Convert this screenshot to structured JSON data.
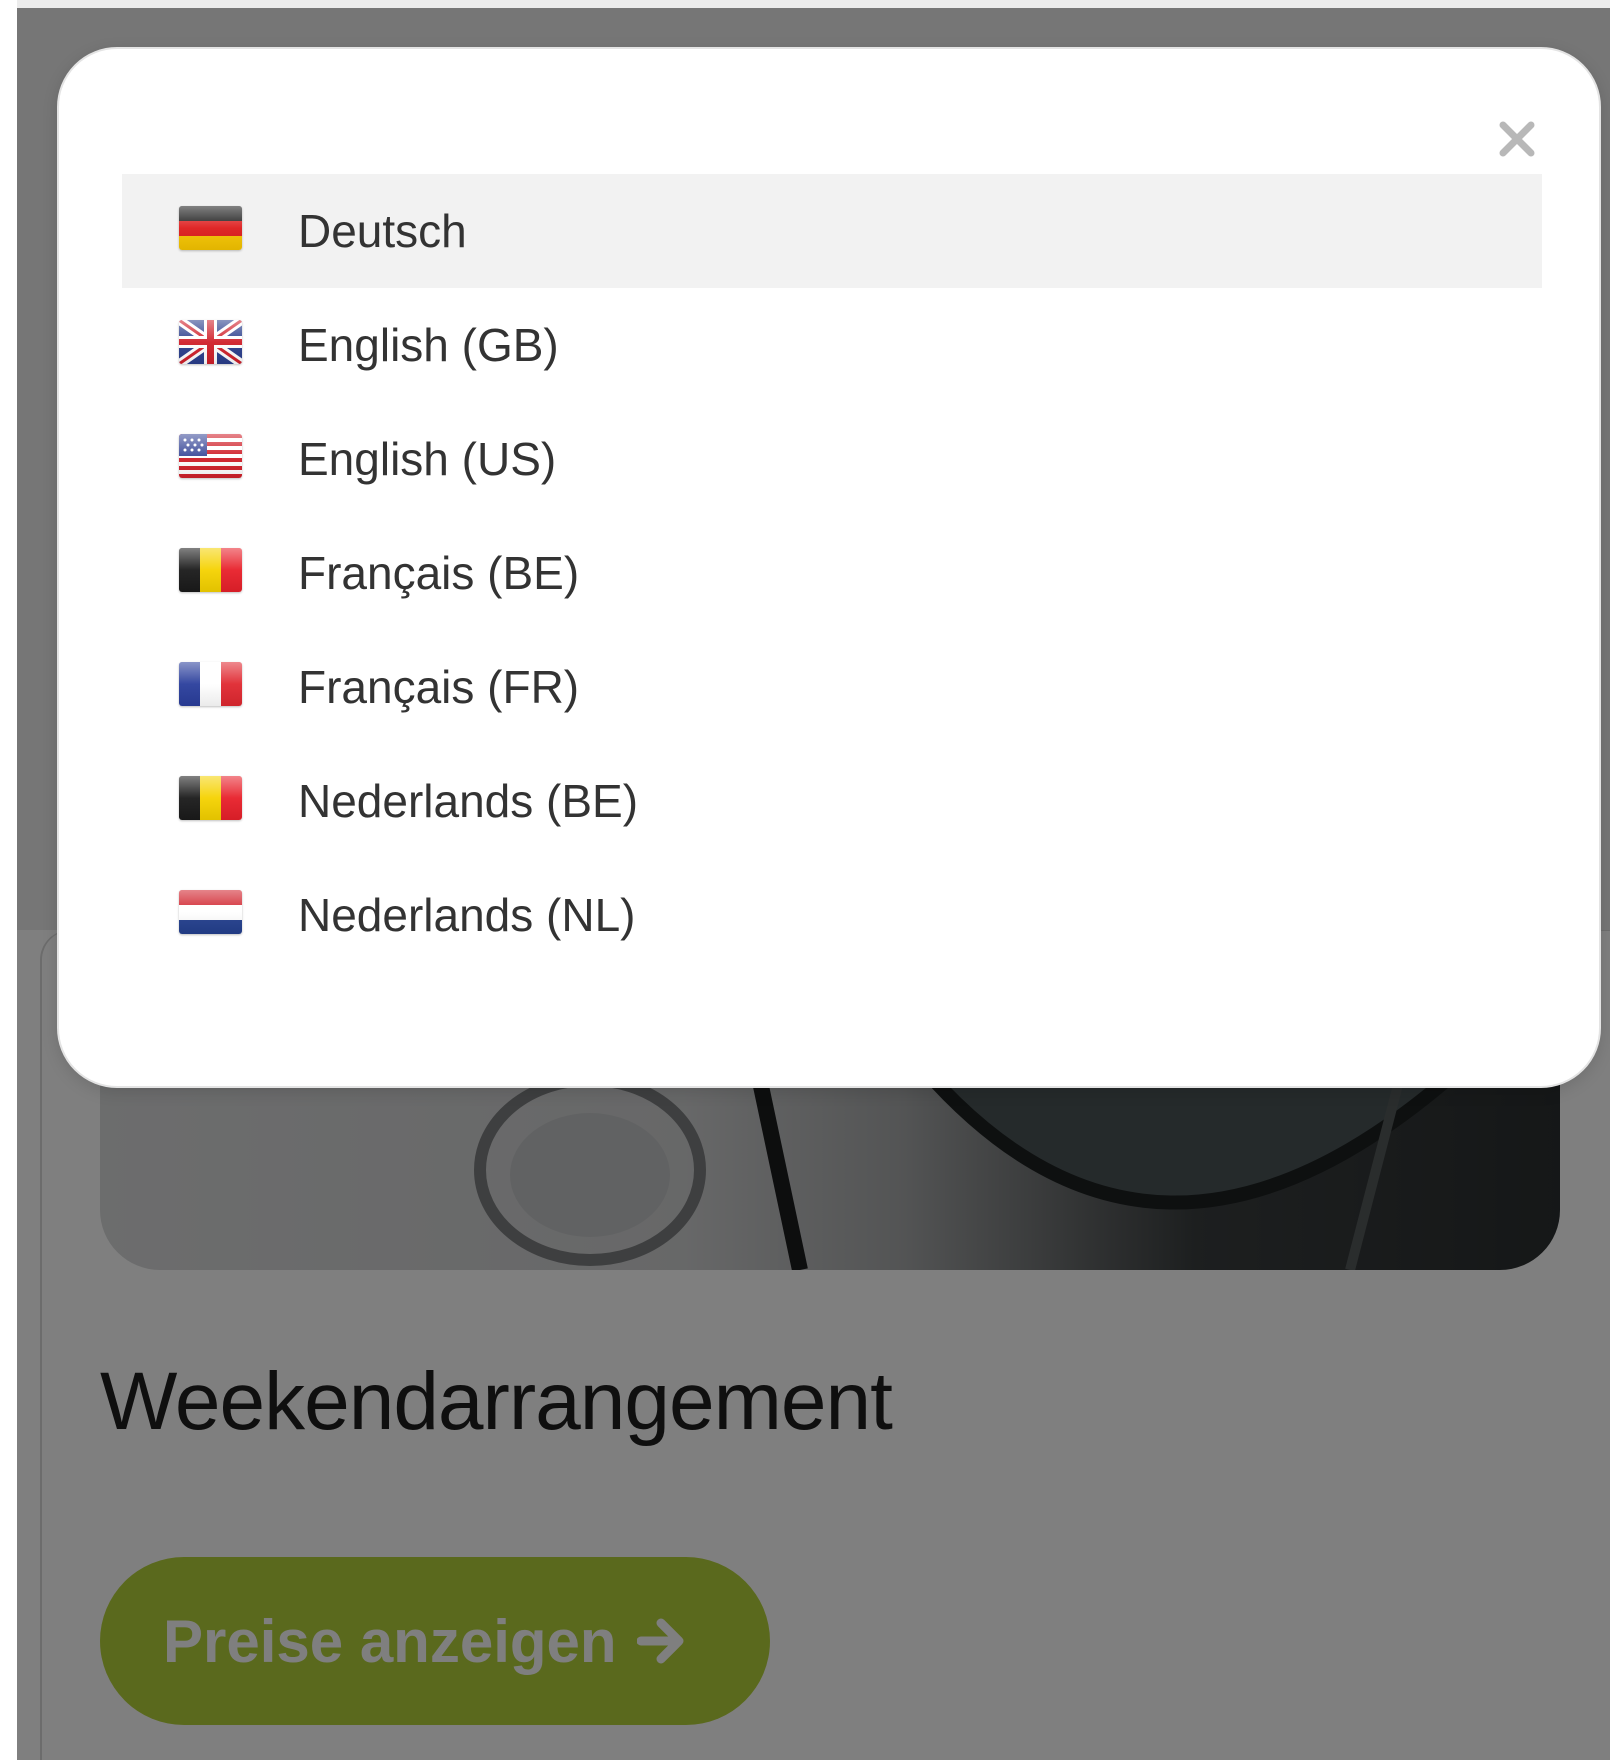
{
  "background_page": {
    "title": "Weekendarrangement",
    "button_label": "Preise anzeigen",
    "button_icon": "arrow-right-icon",
    "button_color": "#b4d33a"
  },
  "language_modal": {
    "close_icon": "close-icon",
    "selected": "Deutsch",
    "languages": [
      {
        "label": "Deutsch",
        "flag": "flag-de-icon"
      },
      {
        "label": "English (GB)",
        "flag": "flag-gb-icon"
      },
      {
        "label": "English (US)",
        "flag": "flag-us-icon"
      },
      {
        "label": "Français (BE)",
        "flag": "flag-be-icon"
      },
      {
        "label": "Français (FR)",
        "flag": "flag-fr-icon"
      },
      {
        "label": "Nederlands (BE)",
        "flag": "flag-be-icon"
      },
      {
        "label": "Nederlands (NL)",
        "flag": "flag-nl-icon"
      }
    ]
  }
}
